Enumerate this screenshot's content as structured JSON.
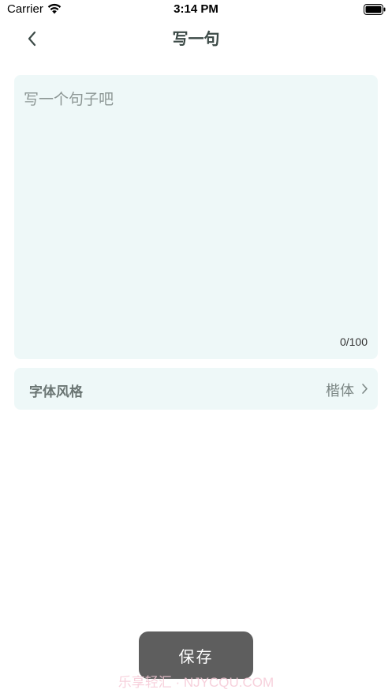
{
  "status_bar": {
    "carrier": "Carrier",
    "time": "3:14 PM",
    "wifi_icon": "wifi-icon",
    "battery_icon": "battery-icon"
  },
  "nav": {
    "back_icon": "chevron-left-icon",
    "title": "写一句"
  },
  "editor": {
    "placeholder": "写一个句子吧",
    "value": "",
    "counter": "0/100"
  },
  "font_style": {
    "label": "字体风格",
    "value": "楷体",
    "chevron_icon": "chevron-right-icon"
  },
  "save_button": {
    "label": "保存"
  },
  "watermark": {
    "text": "乐享轻汇 · NJYCQU.COM"
  },
  "colors": {
    "card_background": "#eef8f8",
    "title_color": "#3c4a47",
    "button_background": "#5e5e5e",
    "watermark_color": "#f6c9d6"
  }
}
